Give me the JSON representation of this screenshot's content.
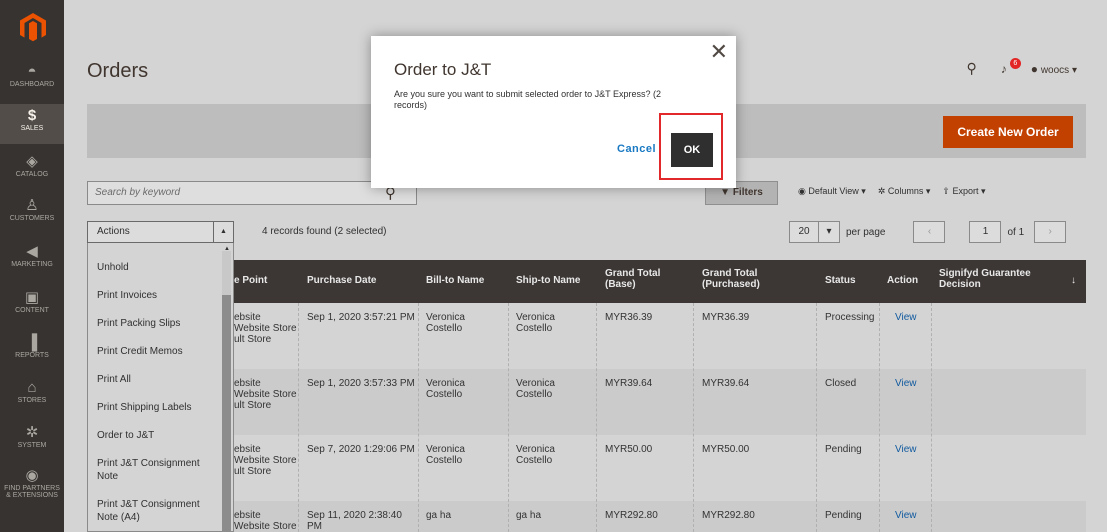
{
  "sidebar": {
    "items": [
      {
        "label": "DASHBOARD",
        "icon": "speedometer-icon"
      },
      {
        "label": "SALES",
        "icon": "dollar-icon"
      },
      {
        "label": "CATALOG",
        "icon": "cube-icon"
      },
      {
        "label": "CUSTOMERS",
        "icon": "person-icon"
      },
      {
        "label": "MARKETING",
        "icon": "megaphone-icon"
      },
      {
        "label": "CONTENT",
        "icon": "layout-icon"
      },
      {
        "label": "REPORTS",
        "icon": "bar-chart-icon"
      },
      {
        "label": "STORES",
        "icon": "storefront-icon"
      },
      {
        "label": "SYSTEM",
        "icon": "gear-icon"
      },
      {
        "label": "FIND PARTNERS",
        "label2": "& EXTENSIONS",
        "icon": "box-icon"
      }
    ]
  },
  "header": {
    "title": "Orders",
    "notification_count": "6",
    "user": "woocs",
    "create_label": "Create New Order"
  },
  "toolbar": {
    "search_placeholder": "Search by keyword",
    "filters_label": "Filters",
    "view_label": "Default View",
    "columns_label": "Columns",
    "export_label": "Export",
    "actions_label": "Actions",
    "records_text": "4 records found (2 selected)",
    "per_page_value": "20",
    "per_page_label": "per page",
    "page_value": "1",
    "page_of": "of 1"
  },
  "dropdown": [
    "Unhold",
    "Print Invoices",
    "Print Packing Slips",
    "Print Credit Memos",
    "Print All",
    "Print Shipping Labels",
    "Order to J&T",
    "Print J&T Consignment Note",
    "Print J&T Consignment Note (A4)"
  ],
  "table": {
    "headers": [
      "e Point",
      "Purchase Date",
      "Bill-to Name",
      "Ship-to Name",
      "Grand Total (Base)",
      "Grand Total (Purchased)",
      "Status",
      "Action",
      "Signifyd Guarantee Decision"
    ],
    "sort_icon": "↓",
    "rows": [
      {
        "point": "ebsite\nWebsite Store\nult Store",
        "date": "Sep 1, 2020 3:57:21 PM",
        "bill": "Veronica\nCostello",
        "ship": "Veronica\nCostello",
        "base": "MYR36.39",
        "purchased": "MYR36.39",
        "status": "Processing",
        "action": "View"
      },
      {
        "point": "ebsite\nWebsite Store\nult Store",
        "date": "Sep 1, 2020 3:57:33 PM",
        "bill": "Veronica\nCostello",
        "ship": "Veronica\nCostello",
        "base": "MYR39.64",
        "purchased": "MYR39.64",
        "status": "Closed",
        "action": "View"
      },
      {
        "point": "ebsite\nWebsite Store\nult Store",
        "date": "Sep 7, 2020 1:29:06 PM",
        "bill": "Veronica\nCostello",
        "ship": "Veronica\nCostello",
        "base": "MYR50.00",
        "purchased": "MYR50.00",
        "status": "Pending",
        "action": "View"
      },
      {
        "point": "ebsite\nWebsite Store",
        "date": "Sep 11, 2020 2:38:40\nPM",
        "bill": "ga ha",
        "ship": "ga ha",
        "base": "MYR292.80",
        "purchased": "MYR292.80",
        "status": "Pending",
        "action": "View"
      }
    ]
  },
  "modal": {
    "title": "Order to J&T",
    "message": "Are you sure you want to submit selected order to J&T Express? (2 records)",
    "cancel_label": "Cancel",
    "ok_label": "OK"
  },
  "colors": {
    "sidebar": "#373330",
    "accent": "#c34100",
    "highlight": "#e3282c",
    "link": "#105a9f"
  }
}
